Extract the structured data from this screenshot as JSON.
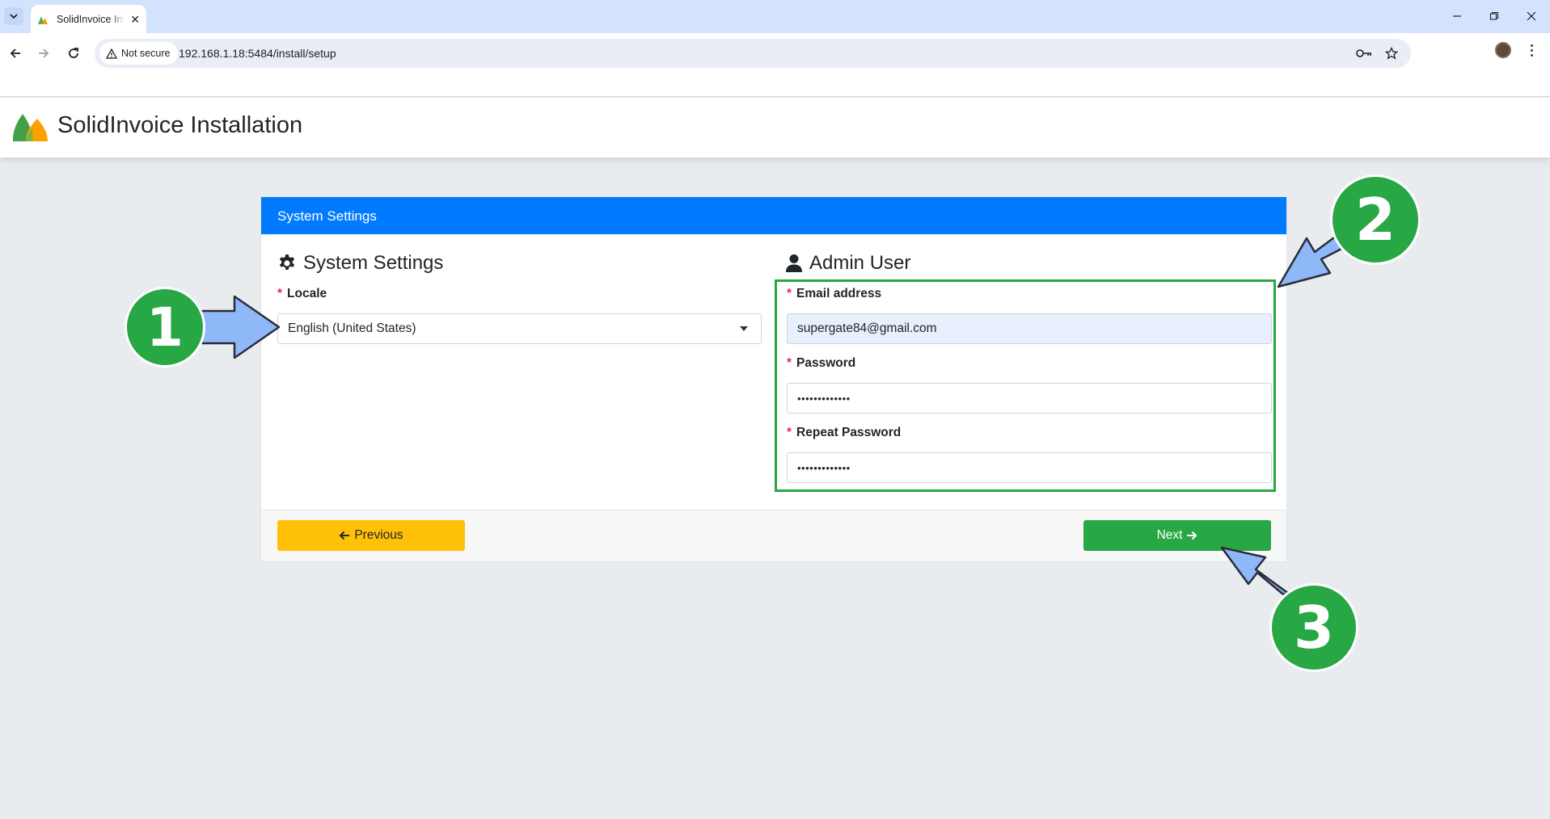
{
  "browser": {
    "tab_title": "SolidInvoice Installation",
    "security_label": "Not secure",
    "url": "192.168.1.18:5484/install/setup"
  },
  "app": {
    "title": "SolidInvoice Installation"
  },
  "card": {
    "header": "System Settings",
    "system_settings": {
      "title": "System Settings",
      "locale_label": "Locale",
      "locale_value": "English (United States)",
      "required_mark": "*"
    },
    "admin_user": {
      "title": "Admin User",
      "email_label": "Email address",
      "email_value": "supergate84@gmail.com",
      "password_label": "Password",
      "password_value": "•••••••••••••",
      "repeat_password_label": "Repeat Password",
      "repeat_password_value": "•••••••••••••",
      "required_mark": "*"
    },
    "footer": {
      "previous_label": "Previous",
      "next_label": "Next"
    }
  },
  "annotations": {
    "step1": "1",
    "step2": "2",
    "step3": "3",
    "badge_color": "#28a745",
    "arrow_color": "#8fb8f8"
  },
  "colors": {
    "card_header": "#007bff",
    "previous_button": "#ffc107",
    "next_button": "#28a745",
    "page_background": "#e9ecef"
  }
}
